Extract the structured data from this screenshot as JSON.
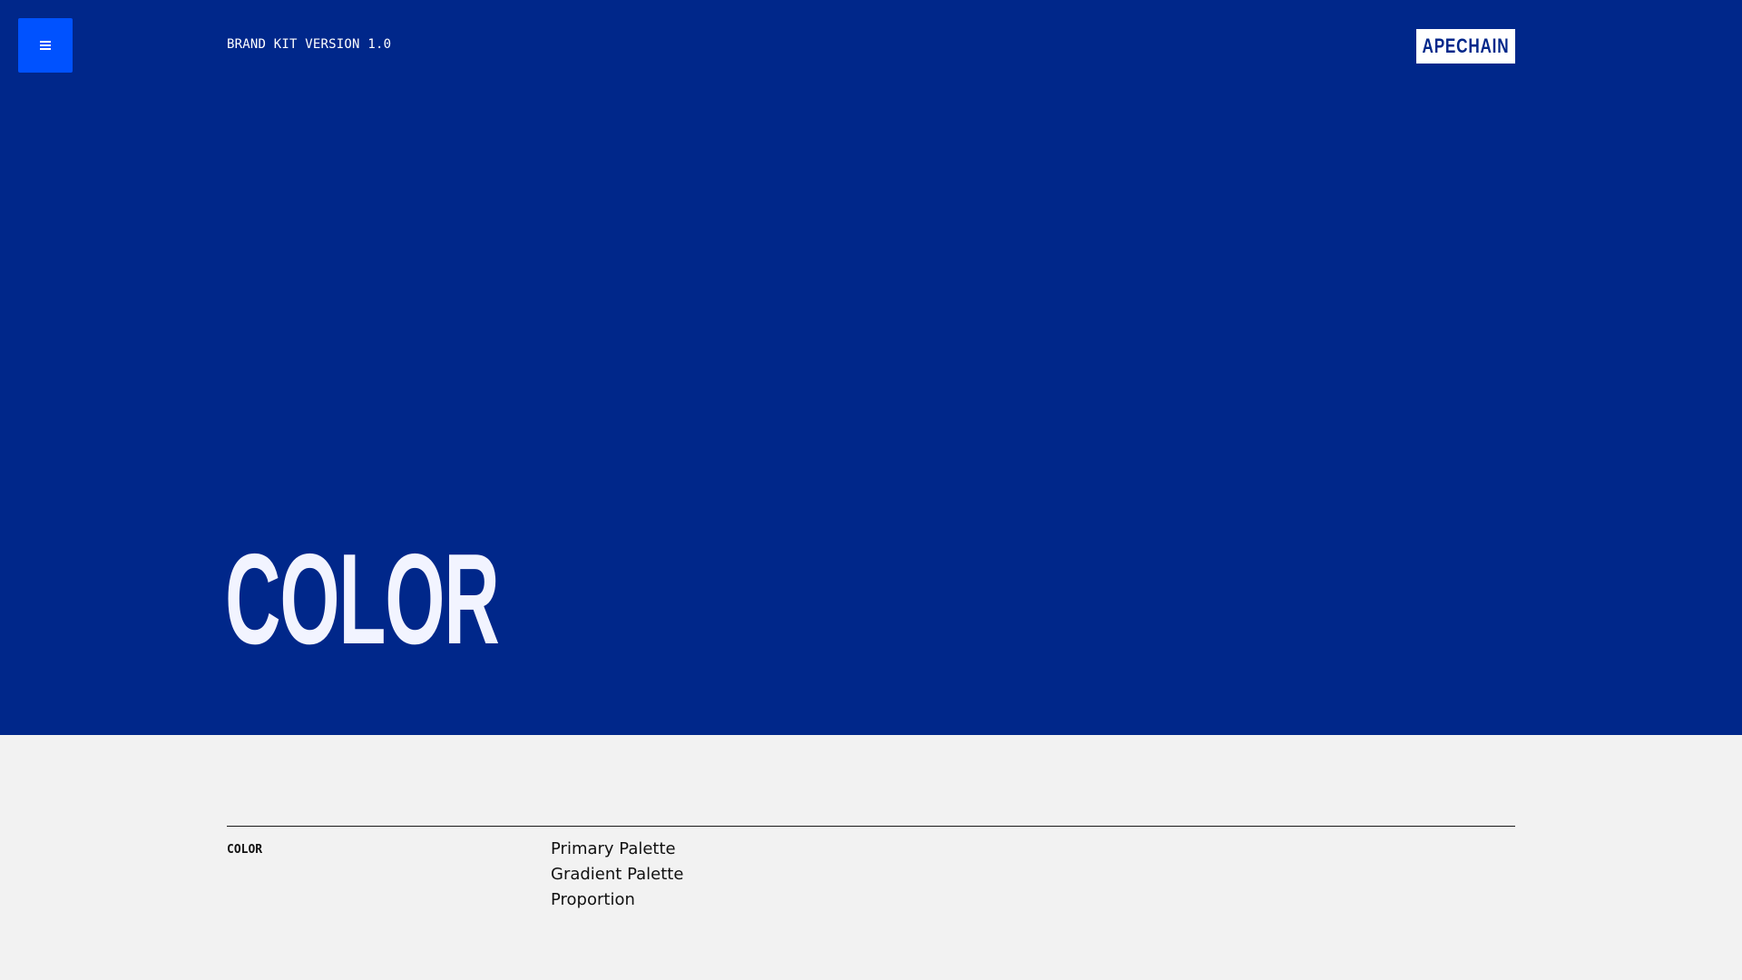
{
  "header": {
    "menu_icon": "hamburger-menu-icon",
    "kit_version": "BRAND KIT VERSION 1.0",
    "logo_text": "APECHAIN"
  },
  "hero": {
    "title": "COLOR"
  },
  "section": {
    "label": "COLOR",
    "links": [
      {
        "label": "Primary Palette"
      },
      {
        "label": "Gradient Palette"
      },
      {
        "label": "Proportion"
      }
    ]
  },
  "colors": {
    "hero_background": "#00278a",
    "menu_button": "#0052ff",
    "page_background": "#f2f2f2",
    "logo_background": "#ffffff"
  }
}
